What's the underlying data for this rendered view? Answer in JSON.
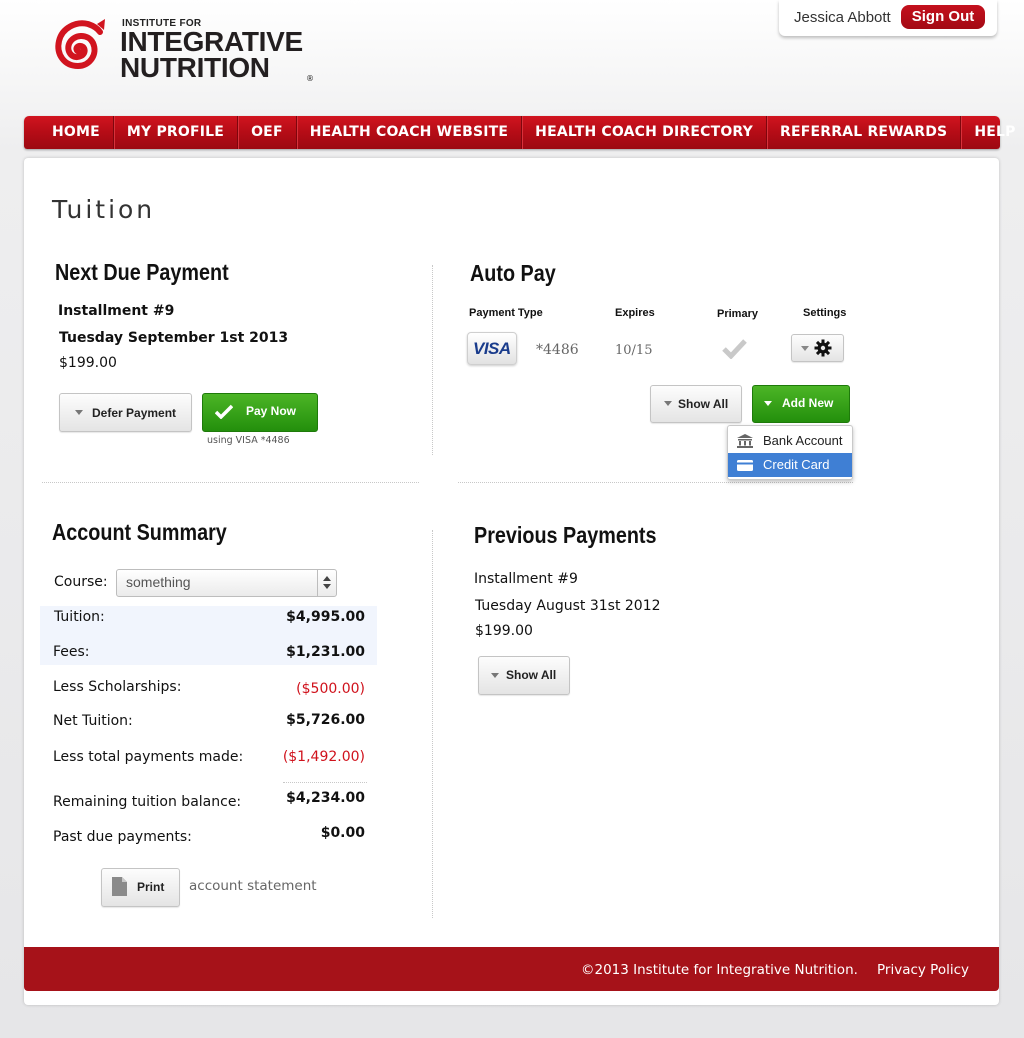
{
  "header": {
    "logo_line1": "INSTITUTE FOR",
    "logo_line2": "INTEGRATIVE",
    "logo_line3": "NUTRITION",
    "logo_reg": "®",
    "user_name": "Jessica Abbott",
    "sign_out": "Sign Out"
  },
  "nav": {
    "items": [
      {
        "label": "HOME"
      },
      {
        "label": "MY PROFILE"
      },
      {
        "label": "OEF"
      },
      {
        "label": "HEALTH COACH WEBSITE"
      },
      {
        "label": "HEALTH COACH DIRECTORY"
      },
      {
        "label": "REFERRAL REWARDS"
      },
      {
        "label": "HELP"
      }
    ]
  },
  "page": {
    "title": "Tuition"
  },
  "next_due": {
    "heading": "Next Due Payment",
    "installment": "Installment #9",
    "date": "Tuesday September 1st  2013",
    "amount": "$199.00",
    "defer_label": "Defer Payment",
    "pay_label": "Pay Now",
    "using": "using VISA *4486"
  },
  "autopay": {
    "heading": "Auto Pay",
    "col_type": "Payment Type",
    "col_expires": "Expires",
    "col_primary": "Primary",
    "col_settings": "Settings",
    "card_brand": "VISA",
    "card_number": "*4486",
    "expires": "10/15",
    "show_all": "Show All",
    "add_new": "Add New",
    "menu": [
      {
        "label": "Bank Account",
        "icon": "bank-icon"
      },
      {
        "label": "Credit Card",
        "icon": "credit-card-icon"
      }
    ]
  },
  "summary": {
    "heading": "Account Summary",
    "course_label": "Course:",
    "course_value": "something",
    "rows": [
      {
        "label": "Tuition:",
        "value": "$4,995.00"
      },
      {
        "label": "Fees:",
        "value": "$1,231.00"
      },
      {
        "label": "Less Scholarships:",
        "value": "($500.00)"
      },
      {
        "label": "Net Tuition:",
        "value": "$5,726.00"
      },
      {
        "label": "Less total payments made:",
        "value": "($1,492.00)"
      },
      {
        "label": "Remaining tuition balance:",
        "value": "$4,234.00"
      },
      {
        "label": "Past due payments:",
        "value": "$0.00"
      }
    ],
    "print_label": "Print",
    "print_caption": "account statement"
  },
  "previous": {
    "heading": "Previous Payments",
    "installment": "Installment #9",
    "date": "Tuesday August 31st  2012",
    "amount": "$199.00",
    "show_all": "Show All"
  },
  "footer": {
    "copyright": "©2013 Institute for Integrative Nutrition.",
    "privacy": "Privacy Policy"
  },
  "colors": {
    "brand_red": "#b50c16",
    "footer_red": "#a61219",
    "green": "#2e9e16",
    "negative": "#d0121c",
    "selection_blue": "#3f7fd4"
  }
}
